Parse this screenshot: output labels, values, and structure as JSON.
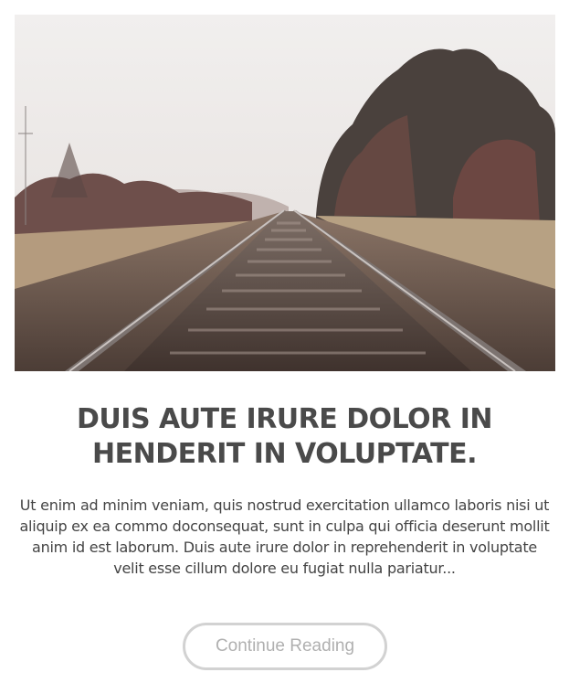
{
  "post": {
    "image_alt": "",
    "title": "DUIS AUTE IRURE DOLOR IN HENDERIT IN VOLUPTATE.",
    "excerpt": "Ut enim ad minim veniam, quis nostrud exercitation ullamco laboris nisi ut aliquip ex ea commo doconsequat, sunt in culpa qui officia deserunt mollit anim id est laborum. Duis aute irure dolor in reprehenderit in voluptate velit esse cillum dolore eu fugiat nulla pariatur...",
    "button_label": "Continue Reading"
  },
  "colors": {
    "title": "#4a4a4a",
    "text": "#444444",
    "button_border": "#d2d2d2",
    "button_text": "#b0b0b0"
  }
}
